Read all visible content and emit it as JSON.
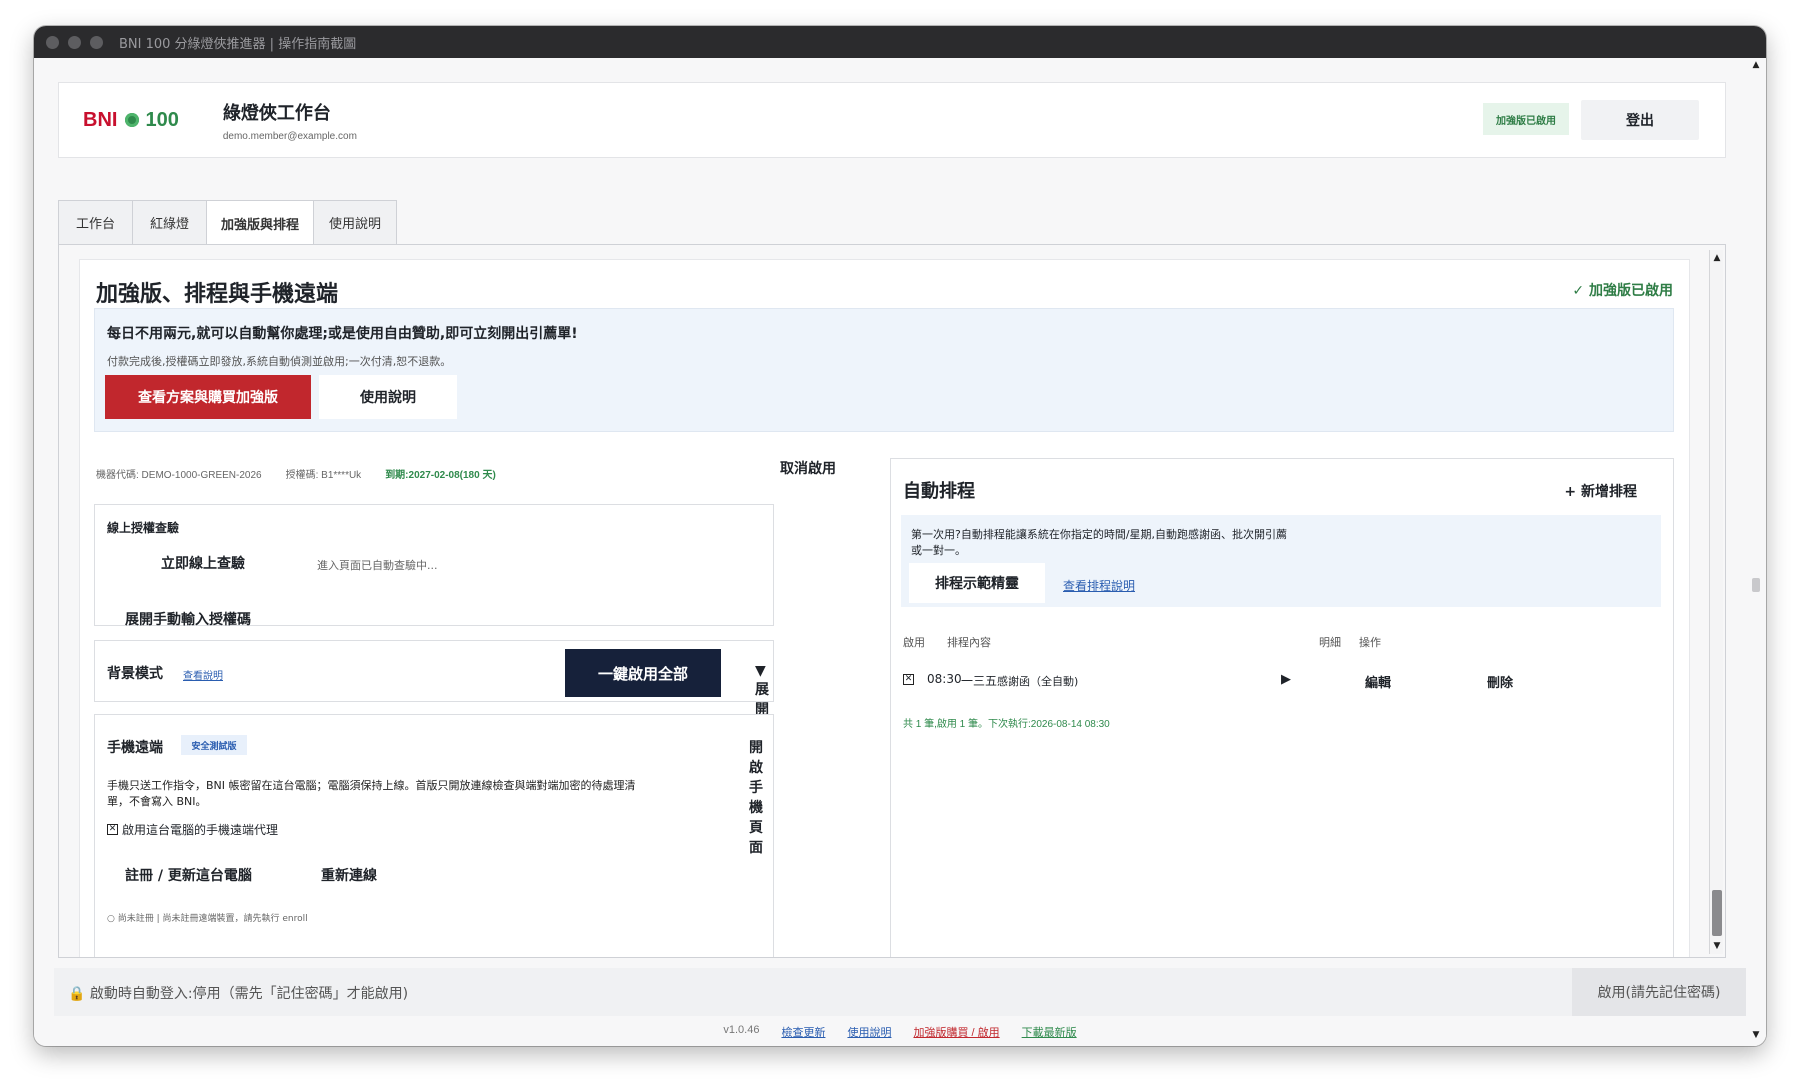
{
  "window": {
    "title": "BNI 100 分綠燈俠推進器 | 操作指南截圖"
  },
  "header": {
    "logo_bni": "BNI",
    "logo_num": "100",
    "title": "綠燈俠工作台",
    "email": "demo.member@example.com",
    "badge": "加強版已啟用",
    "logout": "登出"
  },
  "tabs": [
    {
      "label": "工作台",
      "active": false
    },
    {
      "label": "紅綠燈",
      "active": false
    },
    {
      "label": "加強版與排程",
      "active": true
    },
    {
      "label": "使用說明",
      "active": false
    }
  ],
  "page": {
    "title": "加強版、排程與手機遠端",
    "status": "✓ 加強版已啟用"
  },
  "promo": {
    "headline": "每日不用兩元,就可以自動幫你處理;或是使用自由贊助,即可立刻開出引薦單!",
    "sub": "付款完成後,授權碼立即發放,系統自動偵測並啟用;一次付清,恕不退款。",
    "buy_button": "查看方案與購買加強版",
    "help_button": "使用說明"
  },
  "license": {
    "machine": "機器代碼: DEMO-1000-GREEN-2026",
    "auth": "授權碼: B1****Uk",
    "expiry": "到期:2027-02-08(180 天)",
    "cancel": "取消啟用"
  },
  "online_check": {
    "title": "線上授權查驗",
    "check_button": "立即線上查驗",
    "status": "進入頁面已自動查驗中...",
    "manual": "展開手動輸入授權碼"
  },
  "background": {
    "title": "背景模式",
    "help_link": "查看說明",
    "enable_all": "一鍵啟用全部",
    "expand": "▼ 展開設定"
  },
  "mobile": {
    "title": "手機遠端",
    "tag": "安全測試版",
    "open_page": "開啟手機頁面",
    "desc1": "手機只送工作指令，BNI 帳密留在這台電腦；電腦須保持上線。首版只開放連線檢查與端對端加密的待處理清",
    "desc2": "單，不會寫入 BNI。",
    "checkbox_label": "啟用這台電腦的手機遠端代理",
    "register": "註冊 / 更新這台電腦",
    "reconnect": "重新連線",
    "status": "○ 尚未註冊 | 尚未註冊遠端裝置，請先執行 enroll"
  },
  "schedule": {
    "title": "自動排程",
    "add": "+ 新增排程",
    "info1": "第一次用?自動排程能讓系統在你指定的時間/星期,自動跑感謝函、批次開引薦",
    "info2": "或一對一。",
    "demo_button": "排程示範精靈",
    "help_link": "查看排程說明",
    "columns": {
      "enable": "啟用",
      "content": "排程內容",
      "detail": "明細",
      "action": "操作"
    },
    "rows": [
      {
        "checked": "✕",
        "time": "08:30",
        "days": "一三五",
        "task": "感謝函（全自動)",
        "play": "▶",
        "edit": "編輯",
        "delete": "刪除"
      }
    ],
    "summary": "共 1 筆,啟用 1 筆。下次執行:2026-08-14 08:30"
  },
  "footer": {
    "autologin": "🔒 啟動時自動登入:停用（需先「記住密碼」才能啟用)",
    "autologin_button": "啟用(請先記住密碼)",
    "version": "v1.0.46",
    "links": {
      "update": "檢查更新",
      "help": "使用說明",
      "buy": "加強版購買 / 啟用",
      "download": "下載最新版"
    }
  },
  "colors": {
    "brand_red": "#c1272d",
    "brand_green": "#2f8a4c",
    "dark_button": "#16213a",
    "info_bg": "#eef4fb"
  }
}
